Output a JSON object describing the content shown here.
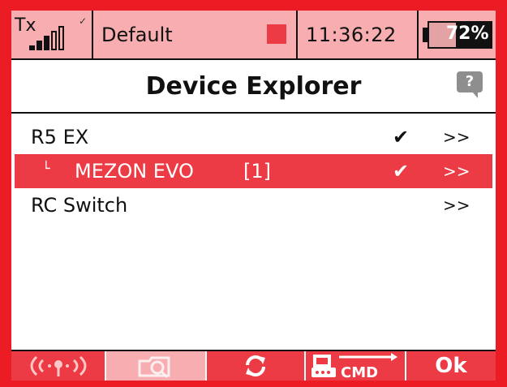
{
  "status_bar": {
    "tx_label": "Tx",
    "model_name": "Default",
    "time": "11:36:22",
    "battery_percent": "72%",
    "battery_level": 0.72
  },
  "header": {
    "title": "Device Explorer",
    "help_glyph": "?"
  },
  "devices": [
    {
      "name": "R5 EX",
      "index": "",
      "check": "✔",
      "arrow": ">>",
      "child": false,
      "selected": false
    },
    {
      "name": "MEZON EVO",
      "index": "[1]",
      "check": "✔",
      "arrow": ">>",
      "child": true,
      "selected": true,
      "branch": "└"
    },
    {
      "name": "RC Switch",
      "index": "",
      "check": "",
      "arrow": ">>",
      "child": false,
      "selected": false
    }
  ],
  "toolbar": {
    "buttons": [
      {
        "icon": "wireless-signal-icon",
        "state": "enabled"
      },
      {
        "icon": "folder-search-icon",
        "state": "disabled"
      },
      {
        "icon": "refresh-icon",
        "state": "enabled"
      },
      {
        "icon": "device-cmd-icon",
        "state": "enabled",
        "label": "CMD"
      },
      {
        "label": "Ok",
        "state": "enabled"
      }
    ]
  },
  "colors": {
    "accent": "#ec1c24",
    "selected_row": "#ec3b45",
    "status_bg": "#f8aeb0"
  }
}
